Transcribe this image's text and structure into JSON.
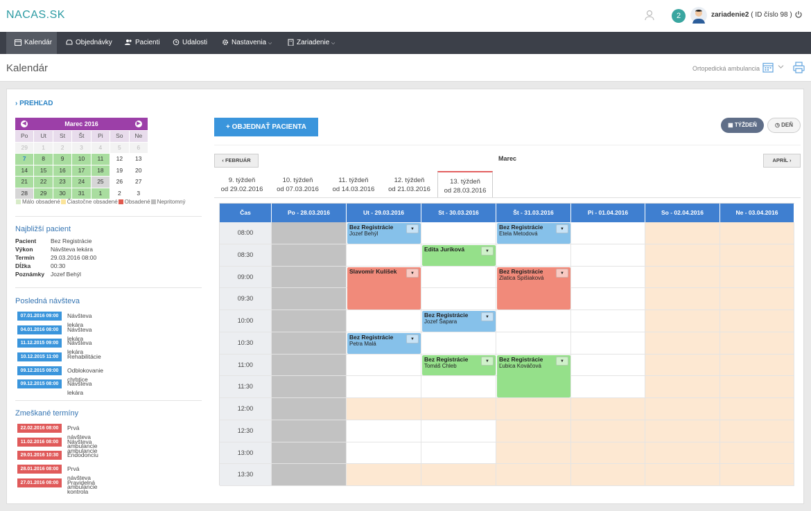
{
  "brand": "NACAS.SK",
  "header": {
    "notifications": "2",
    "user_name": "zariadenie2",
    "user_id": "( ID číslo 98 )"
  },
  "nav": [
    "Kalendár",
    "Objednávky",
    "Pacienti",
    "Udalosti",
    "Nastavenia",
    "Zariadenie"
  ],
  "page": {
    "title": "Kalendár",
    "department": "Ortopedická ambulancia"
  },
  "sidebar": {
    "overview": "PREHĽAD",
    "mini_calendar": {
      "title": "Marec 2016",
      "day_headers": [
        "Po",
        "Ut",
        "St",
        "Št",
        "Pi",
        "So",
        "Ne"
      ],
      "days": [
        "29",
        "1",
        "2",
        "3",
        "4",
        "5",
        "6",
        "7",
        "8",
        "9",
        "10",
        "11",
        "12",
        "13",
        "14",
        "15",
        "16",
        "17",
        "18",
        "19",
        "20",
        "21",
        "22",
        "23",
        "24",
        "25",
        "26",
        "27",
        "28",
        "29",
        "30",
        "31",
        "1",
        "2",
        "3"
      ]
    },
    "legend": [
      "Málo obsadené",
      "Čiastočne obsadené",
      "Obsadené",
      "Nepritomný"
    ],
    "nearest_title": "Najbližší pacient",
    "nearest": [
      {
        "k": "Pacient",
        "v": "Bez Registrácie"
      },
      {
        "k": "Výkon",
        "v": "Návšteva lekára"
      },
      {
        "k": "Termín",
        "v": "29.03.2016 08:00"
      },
      {
        "k": "Dĺžka",
        "v": "00:30"
      },
      {
        "k": "Poznámky",
        "v": "Jozef Behýl"
      }
    ],
    "last_visit_title": "Posledná návšteva",
    "last_visits": [
      {
        "date": "07.01.2016 09:00",
        "text": "Návšteva lekára"
      },
      {
        "date": "04.01.2016 08:00",
        "text": "Návšteva lekára"
      },
      {
        "date": "11.12.2015 09:00",
        "text": "Návšteva lekára"
      },
      {
        "date": "10.12.2015 11:00",
        "text": "Rehabilitácie"
      },
      {
        "date": "09.12.2015 09:00",
        "text": "Odblokovanie chrbtice"
      },
      {
        "date": "09.12.2015 08:00",
        "text": "Návšteva lekára"
      }
    ],
    "missed_title": "Zmeškané termíny",
    "missed": [
      {
        "date": "22.02.2016 08:00",
        "text": "Prvá návšteva ambulancie"
      },
      {
        "date": "11.02.2016 08:00",
        "text": "Návšteva ambulancie"
      },
      {
        "date": "29.01.2016 10:30",
        "text": "Endodonciu"
      },
      {
        "date": "28.01.2016 08:00",
        "text": "Prvá návšteva ambulancie"
      },
      {
        "date": "27.01.2016 08:00",
        "text": "Pravidelná kontrola"
      }
    ]
  },
  "main": {
    "order_button": "OBJEDNAŤ PACIENTA",
    "view_week": "TÝŽDEŇ",
    "view_day": "DEŇ",
    "prev": "FEBRUÁR",
    "next": "APRÍL",
    "month": "Marec",
    "weeks": [
      {
        "label": "9. týždeň",
        "date": "od 29.02.2016"
      },
      {
        "label": "10. týždeň",
        "date": "od 07.03.2016"
      },
      {
        "label": "11. týždeň",
        "date": "od 14.03.2016"
      },
      {
        "label": "12. týždeň",
        "date": "od 21.03.2016"
      },
      {
        "label": "13. týždeň",
        "date": "od 28.03.2016"
      }
    ],
    "columns": [
      "Čas",
      "Po - 28.03.2016",
      "Ut - 29.03.2016",
      "St - 30.03.2016",
      "Št - 31.03.2016",
      "Pi - 01.04.2016",
      "So - 02.04.2016",
      "Ne - 03.04.2016"
    ],
    "times": [
      "08:00",
      "08:30",
      "09:00",
      "09:30",
      "10:00",
      "10:30",
      "11:00",
      "11:30",
      "12:00",
      "12:30",
      "13:00",
      "13:30"
    ],
    "appointments": [
      {
        "day": 1,
        "start": 0,
        "span": 1,
        "title": "Bez Registrácie",
        "sub": "Jozef Behýl",
        "color": "#86c1ea"
      },
      {
        "day": 3,
        "start": 0,
        "span": 1,
        "title": "Bez Registrácie",
        "sub": "Etela Metodová",
        "color": "#86c1ea"
      },
      {
        "day": 2,
        "start": 1,
        "span": 1,
        "title": "Edita Juríková",
        "sub": "",
        "color": "#95e08a"
      },
      {
        "day": 1,
        "start": 2,
        "span": 2,
        "title": "Slavomír Kulíšek",
        "sub": "",
        "color": "#f18a7a"
      },
      {
        "day": 3,
        "start": 2,
        "span": 2,
        "title": "Bez Registrácie",
        "sub": "Zlatica Spišiaková",
        "color": "#f18a7a"
      },
      {
        "day": 2,
        "start": 4,
        "span": 1,
        "title": "Bez Registrácie",
        "sub": "Jozef Šapara",
        "color": "#86c1ea"
      },
      {
        "day": 1,
        "start": 5,
        "span": 1,
        "title": "Bez Registrácie",
        "sub": "Petra Malá",
        "color": "#86c1ea"
      },
      {
        "day": 2,
        "start": 6,
        "span": 1,
        "title": "Bez Registrácie",
        "sub": "Tomáš Chleb",
        "color": "#95e08a"
      },
      {
        "day": 3,
        "start": 6,
        "span": 2,
        "title": "Bez Registrácie",
        "sub": "Ľubica Kováčová",
        "color": "#95e08a"
      }
    ]
  },
  "colors": {
    "legend": [
      "#d7ebc8",
      "#fbe49a",
      "#e05a4e",
      "#bdbdbd"
    ],
    "visit": "#3a95dc",
    "missed": "#e05a5a",
    "closed": "#fde8d2",
    "past": "#c2c2c2"
  }
}
